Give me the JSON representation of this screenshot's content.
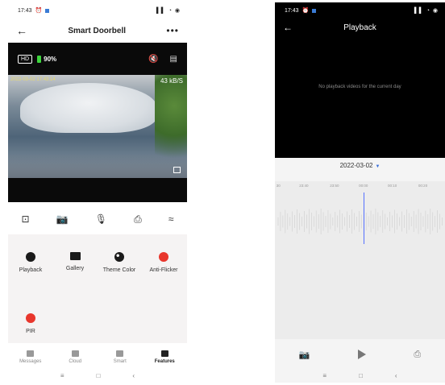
{
  "left": {
    "status": {
      "time": "17:43",
      "indicators": "⏰",
      "right": "▌▌ ◔ ◉"
    },
    "header": {
      "back_icon": "back-arrow-icon",
      "title": "Smart Doorbell",
      "more": "•••"
    },
    "live": {
      "hd_label": "HD",
      "battery": "90%",
      "timestamp": "2022-03-02  17:43:14",
      "rate": "43 kB/S",
      "top_icons": [
        "mute-icon",
        "layout-icon"
      ]
    },
    "controls": [
      "screenshot-icon",
      "camera-icon",
      "mic-icon",
      "record-icon",
      "collapse-icon"
    ],
    "features": [
      {
        "label": "Playback",
        "icon": "play-icon"
      },
      {
        "label": "Gallery",
        "icon": "gallery-icon"
      },
      {
        "label": "Theme Color",
        "icon": "palette-icon"
      },
      {
        "label": "Anti-Flicker",
        "icon": "flash-icon"
      },
      {
        "label": "PIR",
        "icon": "pir-icon"
      }
    ],
    "nav": [
      {
        "label": "Messages"
      },
      {
        "label": "Cloud"
      },
      {
        "label": "Smart"
      },
      {
        "label": "Features",
        "active": true
      }
    ],
    "sysnav": [
      "≡",
      "□",
      "‹"
    ]
  },
  "right": {
    "status": {
      "time": "17:43",
      "indicators": "⏰",
      "right": "▌▌ ◔ ◉"
    },
    "header": {
      "title": "Playback"
    },
    "empty_message": "No playback videos for the current day",
    "date": "2022-03-02",
    "date_caret": "▼",
    "ticks": [
      {
        "label": "30",
        "pos": 0.02
      },
      {
        "label": "23:40",
        "pos": 0.17
      },
      {
        "label": "23:50",
        "pos": 0.35
      },
      {
        "label": "00:00",
        "pos": 0.52
      },
      {
        "label": "00:10",
        "pos": 0.69
      },
      {
        "label": "00:20",
        "pos": 0.87
      }
    ],
    "sysnav": [
      "≡",
      "□",
      "‹"
    ]
  }
}
